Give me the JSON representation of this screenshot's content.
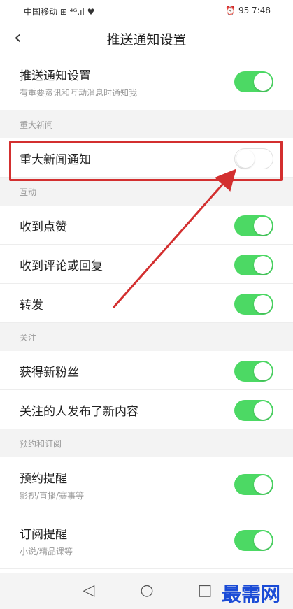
{
  "status_bar": {
    "left": "中国移动 ⊞ ⁴ᴳ.ıl ♥",
    "right": "⏰ 95 7:48"
  },
  "nav": {
    "title": "推送通知设置",
    "back_icon": "chevron-left"
  },
  "main": {
    "title": "推送通知设置",
    "subtitle": "有重要资讯和互动消息时通知我",
    "enabled": true
  },
  "sections": [
    {
      "header": "重大新闻",
      "items": [
        {
          "title": "重大新闻通知",
          "enabled": false
        }
      ]
    },
    {
      "header": "互动",
      "items": [
        {
          "title": "收到点赞",
          "enabled": true
        },
        {
          "title": "收到评论或回复",
          "enabled": true
        },
        {
          "title": "转发",
          "enabled": true
        }
      ]
    },
    {
      "header": "关注",
      "items": [
        {
          "title": "获得新粉丝",
          "enabled": true
        },
        {
          "title": "关注的人发布了新内容",
          "enabled": true
        }
      ]
    },
    {
      "header": "预约和订阅",
      "items": [
        {
          "title": "预约提醒",
          "subtitle": "影视/直播/赛事等",
          "enabled": true
        },
        {
          "title": "订阅提醒",
          "subtitle": "小说/精品课等",
          "enabled": true
        }
      ]
    }
  ],
  "bottom_nav": {
    "back": "◁",
    "home": "○",
    "recent": "□"
  },
  "watermark": "最需网",
  "colors": {
    "toggle_on": "#4cd964",
    "highlight": "#d32f2f",
    "watermark": "#1a4bd6"
  }
}
